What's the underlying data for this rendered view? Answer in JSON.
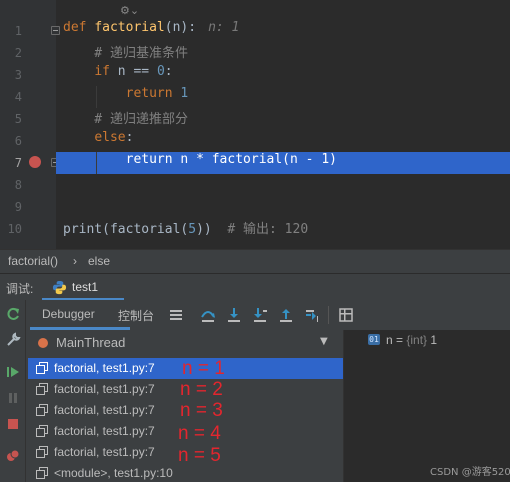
{
  "editor": {
    "lines": [
      {
        "n": "1",
        "parts": [
          {
            "t": "def ",
            "c": "kw"
          },
          {
            "t": "factorial",
            "c": "fn-def"
          },
          {
            "t": "(n):",
            "c": ""
          }
        ],
        "hint": "n: 1"
      },
      {
        "n": "2",
        "parts": [
          {
            "t": "    # 递归基准条件",
            "c": "cmt"
          }
        ]
      },
      {
        "n": "3",
        "parts": [
          {
            "t": "    ",
            "c": ""
          },
          {
            "t": "if",
            "c": "kw"
          },
          {
            "t": " n == ",
            "c": ""
          },
          {
            "t": "0",
            "c": "num"
          },
          {
            "t": ":",
            "c": ""
          }
        ]
      },
      {
        "n": "4",
        "parts": [
          {
            "t": "        ",
            "c": ""
          },
          {
            "t": "return ",
            "c": "kw"
          },
          {
            "t": "1",
            "c": "num"
          }
        ]
      },
      {
        "n": "5",
        "parts": [
          {
            "t": "    # 递归递推部分",
            "c": "cmt"
          }
        ]
      },
      {
        "n": "6",
        "parts": [
          {
            "t": "    ",
            "c": ""
          },
          {
            "t": "else",
            "c": "kw"
          },
          {
            "t": ":",
            "c": ""
          }
        ]
      },
      {
        "n": "7",
        "parts": [
          {
            "t": "        ",
            "c": ""
          },
          {
            "t": "return ",
            "c": "kw"
          },
          {
            "t": "n * factorial(n - ",
            "c": ""
          },
          {
            "t": "1",
            "c": "num"
          },
          {
            "t": ")",
            "c": ""
          }
        ],
        "highlight": true
      },
      {
        "n": "8",
        "parts": []
      },
      {
        "n": "9",
        "parts": []
      },
      {
        "n": "10",
        "parts": [
          {
            "t": "print",
            "c": ""
          },
          {
            "t": "(factorial(",
            "c": ""
          },
          {
            "t": "5",
            "c": "num"
          },
          {
            "t": "))  ",
            "c": ""
          },
          {
            "t": "# 输出: 120",
            "c": "cmt"
          }
        ]
      }
    ]
  },
  "breadcrumb": {
    "items": [
      "factorial()",
      "›",
      "else"
    ]
  },
  "debug": {
    "title": "调试:",
    "run_tab": "test1",
    "tabs": {
      "debugger": "Debugger",
      "console": "控制台"
    },
    "thread": "MainThread",
    "frames": [
      {
        "label": "factorial, test1.py:7",
        "selected": true
      },
      {
        "label": "factorial, test1.py:7"
      },
      {
        "label": "factorial, test1.py:7"
      },
      {
        "label": "factorial, test1.py:7"
      },
      {
        "label": "factorial, test1.py:7"
      },
      {
        "label": "<module>, test1.py:10"
      }
    ],
    "annotations": [
      "n = 1",
      "n = 2",
      "n = 3",
      "n = 4",
      "n = 5"
    ],
    "variable": {
      "icon": "01",
      "name": "n = ",
      "type": "{int}",
      "value": " 1"
    }
  },
  "watermark": "CSDN @游客520",
  "colors": {
    "highlight": "#2f65ca",
    "breakpoint": "#c75450",
    "annotation": "#e3262e"
  }
}
